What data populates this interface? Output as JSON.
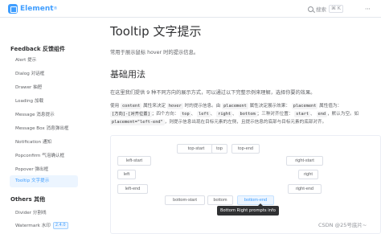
{
  "header": {
    "logo": "Element",
    "logo_mark": "®",
    "search_label": "搜索",
    "shortcut": "⌘ K",
    "more": "⋯"
  },
  "sidebar": {
    "groups": [
      {
        "title": "Feedback 反馈组件",
        "items": [
          {
            "label": "Alert 提示"
          },
          {
            "label": "Dialog 对话框"
          },
          {
            "label": "Drawer 抽屉"
          },
          {
            "label": "Loading 加载"
          },
          {
            "label": "Message 消息提示"
          },
          {
            "label": "Message Box 消息弹出框"
          },
          {
            "label": "Notification 通知"
          },
          {
            "label": "Popconfirm 气泡确认框"
          },
          {
            "label": "Popover 弹出框"
          },
          {
            "label": "Tooltip 文字提示",
            "active": true
          }
        ]
      },
      {
        "title": "Others 其他",
        "items": [
          {
            "label": "Divider 分割线"
          },
          {
            "label": "Watermark 水印",
            "badge": "2.4.0"
          }
        ]
      }
    ]
  },
  "main": {
    "title": "Tooltip 文字提示",
    "intro": "常用于展示鼠标 hover 时的提示信息。",
    "section_title": "基础用法",
    "section_desc": "在这里我们提供 9 种不同方向的展示方式，可以通过以下完整示例来理解，选择你要的效果。",
    "usage": {
      "t1": "使用 ",
      "c1": "content",
      "t2": " 属性来决定 ",
      "c2": "hover",
      "t3": " 时的提示信息。由 ",
      "c3": "placement",
      "t4": " 属性决定展示效果： ",
      "c4": "placement",
      "t5": " 属性值为： ",
      "c5": "[方向]-[对齐位置]",
      "t6": "；四个方向： ",
      "c6": "top",
      "t7": "、 ",
      "c7": "left",
      "t8": "、 ",
      "c8": "right",
      "t9": "、 ",
      "c9": "bottom",
      "t10": "；三种对齐位置： ",
      "c10": "start",
      "t11": "、 ",
      "c11": "end",
      "t12": "，默认为空。如 ",
      "c12": "placement=\"left-end\"",
      "t13": "，则提示信息出现在目标元素的左侧，且提示信息的底部与目标元素的底部对齐。"
    }
  },
  "demo": {
    "buttons": {
      "top_start": "top-start",
      "top": "top",
      "top_end": "top-end",
      "left_start": "left-start",
      "right_start": "right-start",
      "left": "left",
      "right": "right",
      "left_end": "left-end",
      "right_end": "right-end",
      "bottom_start": "bottom-start",
      "bottom": "bottom",
      "bottom_end": "bottom-end"
    },
    "hovered": "bottom-end",
    "tooltip": "Bottom Right prompts info"
  },
  "watermark": "CSDN @25号底片~",
  "colors": {
    "primary": "#409eff",
    "active_bg": "#ecf5ff",
    "tooltip_bg": "#303133"
  }
}
